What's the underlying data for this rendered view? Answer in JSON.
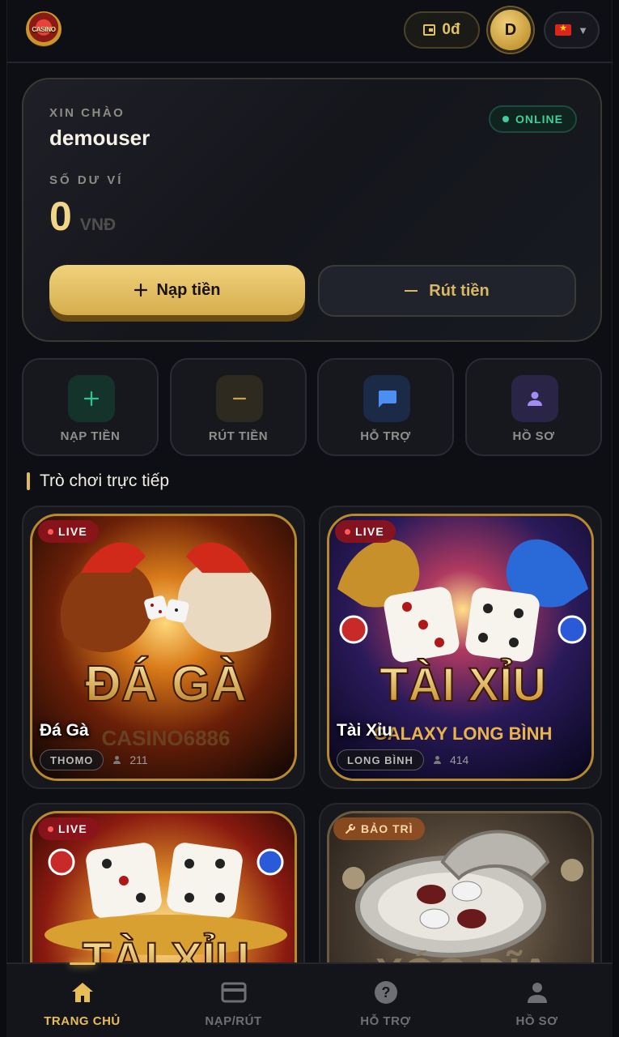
{
  "header": {
    "logo_text": "CASINO",
    "wallet_amount": "0đ",
    "avatar_initial": "D",
    "language_caret": "▼"
  },
  "balance_card": {
    "greeting_label": "XIN CHÀO",
    "username": "demouser",
    "status": "ONLINE",
    "wallet_label": "SỐ DƯ VÍ",
    "amount": "0",
    "currency": "VNĐ",
    "deposit_label": "Nạp tiền",
    "withdraw_label": "Rút tiền"
  },
  "quick_actions": [
    {
      "label": "NẠP TIỀN",
      "icon": "plus-icon",
      "color": "#1f8f68"
    },
    {
      "label": "RÚT TIỀN",
      "icon": "minus-icon",
      "color": "#c49a3e"
    },
    {
      "label": "HỖ TRỢ",
      "icon": "chat-icon",
      "color": "#3b78d8"
    },
    {
      "label": "HỒ SƠ",
      "icon": "user-icon",
      "color": "#8f74e6"
    }
  ],
  "section": {
    "title": "Trò chơi trực tiếp"
  },
  "games": [
    {
      "name": "Đá Gà",
      "art_title": "ĐÁ GÀ",
      "art_subtitle": "CASINO6886",
      "badge": "LIVE",
      "tag": "THOMO",
      "players": "211"
    },
    {
      "name": "Tài Xỉu",
      "art_title": "TÀI XỈU",
      "art_subtitle": "GALAXY LONG BÌNH",
      "badge": "LIVE",
      "tag": "LONG BÌNH",
      "players": "414"
    },
    {
      "name": "",
      "art_title": "TÀI XỈU",
      "art_subtitle": "",
      "badge": "LIVE",
      "tag": "",
      "players": ""
    },
    {
      "name": "",
      "art_title": "XÓC ĐĨA",
      "art_subtitle": "",
      "badge": "BẢO TRÌ",
      "tag": "",
      "players": ""
    }
  ],
  "bottom_nav": [
    {
      "label": "TRANG CHỦ",
      "icon": "home-icon",
      "active": true
    },
    {
      "label": "NẠP/RÚT",
      "icon": "card-icon",
      "active": false
    },
    {
      "label": "HỖ TRỢ",
      "icon": "help-icon",
      "active": false
    },
    {
      "label": "HỒ SƠ",
      "icon": "profile-icon",
      "active": false
    }
  ],
  "colors": {
    "gold": "#e7bd55",
    "online": "#3ecf9a",
    "live": "#8c141c",
    "background": "#0d0f15"
  }
}
